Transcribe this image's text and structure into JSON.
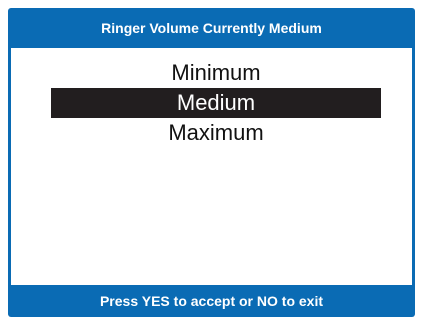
{
  "screen": {
    "title": "Ringer Volume Currently Medium",
    "footer": "Press YES to accept or NO to exit"
  },
  "menu": {
    "options": [
      {
        "label": "Minimum",
        "selected": false
      },
      {
        "label": "Medium",
        "selected": true
      },
      {
        "label": "Maximum",
        "selected": false
      }
    ]
  },
  "colors": {
    "frame": "#0a6bb4",
    "selection": "#221e1f",
    "background": "#ffffff"
  }
}
